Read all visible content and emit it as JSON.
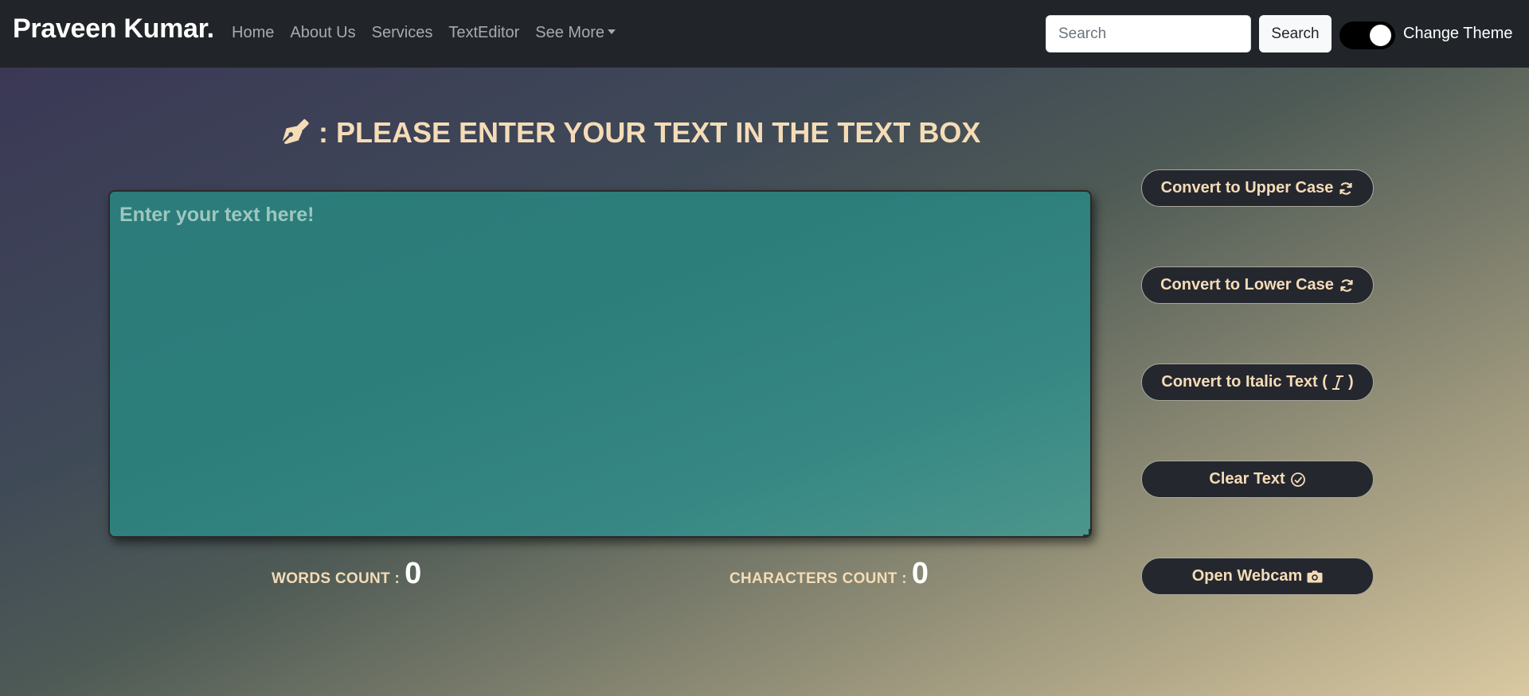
{
  "navbar": {
    "brand": "Praveen Kumar.",
    "links": [
      "Home",
      "About Us",
      "Services",
      "TextEditor",
      "See More"
    ],
    "search_placeholder": "Search",
    "search_button": "Search",
    "theme_toggle_on": true,
    "theme_label": "Change Theme"
  },
  "heading": {
    "icon": "pen-nib-icon",
    "text": ": PLEASE ENTER YOUR TEXT IN THE TEXT BOX"
  },
  "editor": {
    "placeholder": "Enter your text here!",
    "value": ""
  },
  "counts": {
    "words_label": "WORDS COUNT :",
    "words_value": "0",
    "chars_label": "CHARACTERS COUNT :",
    "chars_value": "0"
  },
  "buttons": {
    "upper": "Convert to Upper Case",
    "lower": "Convert to Lower Case",
    "italic": "Convert to Italic Text (",
    "italic_close": ")",
    "clear": "Clear Text",
    "webcam": "Open Webcam"
  },
  "colors": {
    "navbar_bg": "#212529",
    "accent_text": "#f5dcb6",
    "editor_bg": "#2c7e7b",
    "button_bg": "#25272f"
  }
}
